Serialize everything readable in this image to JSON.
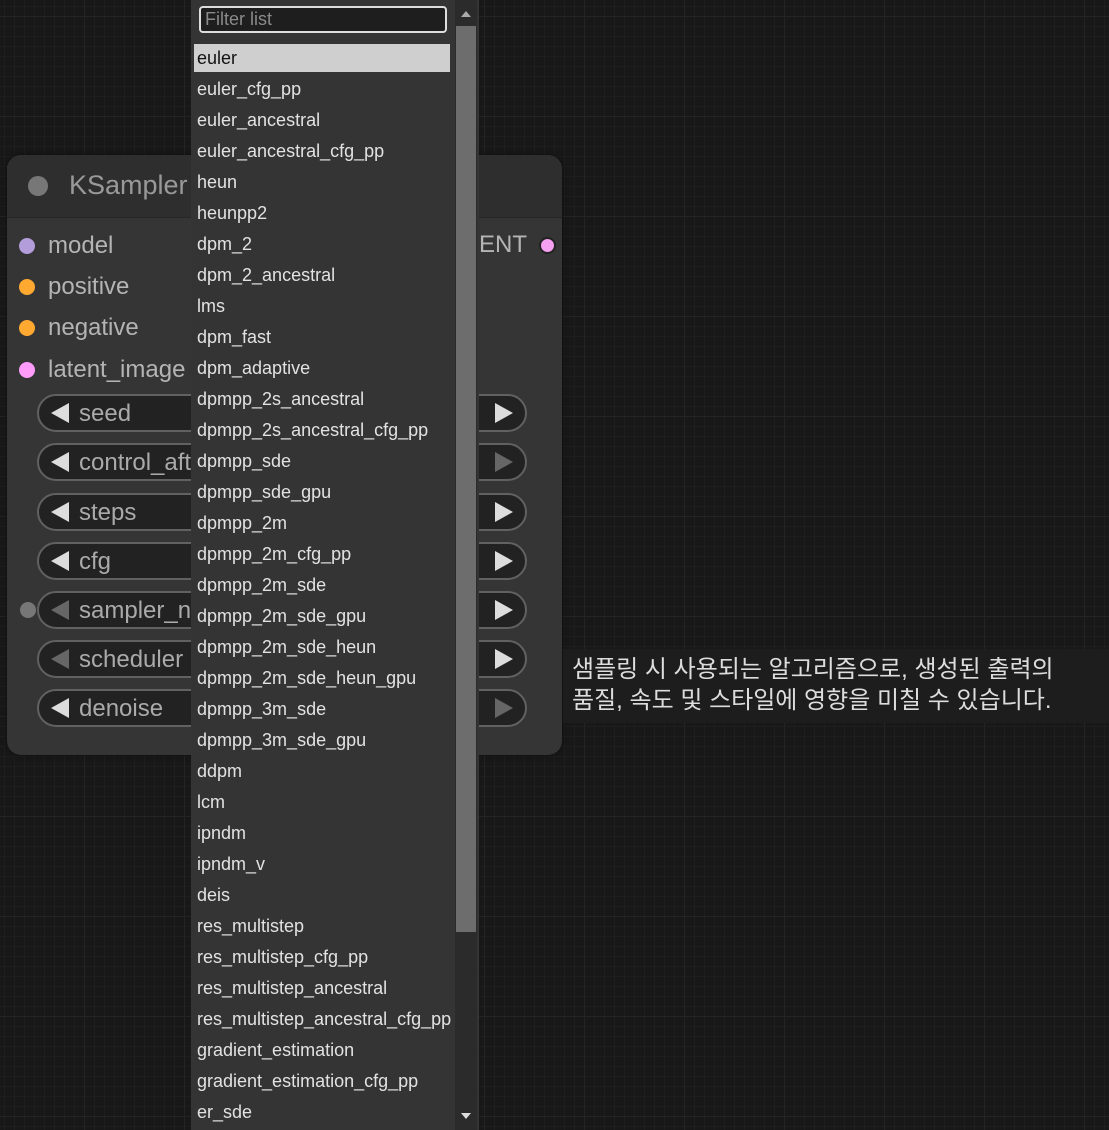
{
  "node": {
    "title": "KSampler",
    "inputs": [
      {
        "label": "model",
        "color": "#b39ddb"
      },
      {
        "label": "positive",
        "color": "#ffa931"
      },
      {
        "label": "negative",
        "color": "#ffa931"
      },
      {
        "label": "latent_image",
        "color": "#ff9cf9"
      }
    ],
    "output": {
      "label": "LATENT",
      "color": "#ff9cf9"
    },
    "widgets": [
      {
        "label": "seed"
      },
      {
        "label": "control_after_generate"
      },
      {
        "label": "steps"
      },
      {
        "label": "cfg"
      },
      {
        "label": "sampler_name"
      },
      {
        "label": "scheduler"
      },
      {
        "label": "denoise"
      }
    ]
  },
  "dropdown": {
    "filter_placeholder": "Filter list",
    "selected": "euler",
    "items": [
      "euler",
      "euler_cfg_pp",
      "euler_ancestral",
      "euler_ancestral_cfg_pp",
      "heun",
      "heunpp2",
      "dpm_2",
      "dpm_2_ancestral",
      "lms",
      "dpm_fast",
      "dpm_adaptive",
      "dpmpp_2s_ancestral",
      "dpmpp_2s_ancestral_cfg_pp",
      "dpmpp_sde",
      "dpmpp_sde_gpu",
      "dpmpp_2m",
      "dpmpp_2m_cfg_pp",
      "dpmpp_2m_sde",
      "dpmpp_2m_sde_gpu",
      "dpmpp_2m_sde_heun",
      "dpmpp_2m_sde_heun_gpu",
      "dpmpp_3m_sde",
      "dpmpp_3m_sde_gpu",
      "ddpm",
      "lcm",
      "ipndm",
      "ipndm_v",
      "deis",
      "res_multistep",
      "res_multistep_cfg_pp",
      "res_multistep_ancestral",
      "res_multistep_ancestral_cfg_pp",
      "gradient_estimation",
      "gradient_estimation_cfg_pp",
      "er_sde"
    ]
  },
  "tooltip": {
    "text": "샘플링 시 사용되는 알고리즘으로, 생성된 출력의\n품질, 속도 및 스타일에 영향을 미칠 수 있습니다."
  }
}
